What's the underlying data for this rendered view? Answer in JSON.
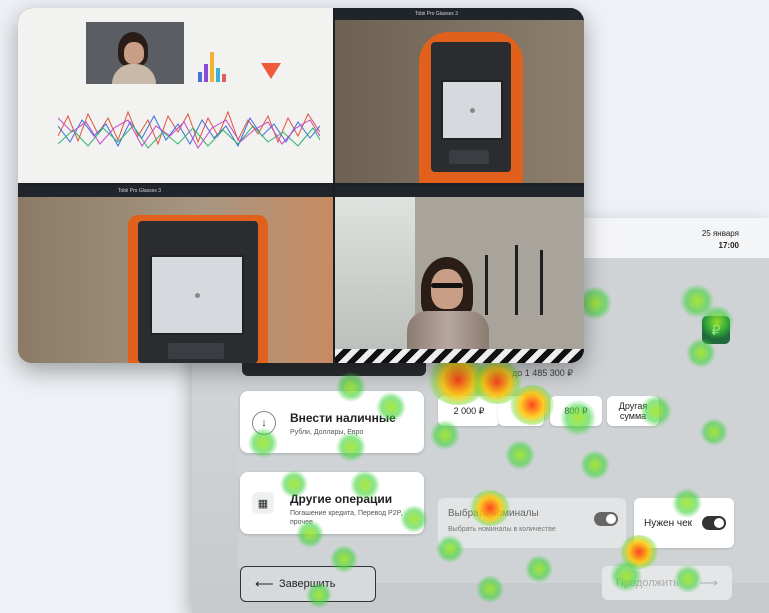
{
  "atm": {
    "date": "25 января",
    "time": "17:00",
    "ruble_icon": "₽",
    "limit_text": "до 1 485 300 ₽",
    "deposit": {
      "title": "Внести наличные",
      "subtitle": "Рубли, Доллары, Евро"
    },
    "other": {
      "title": "Другие операции",
      "subtitle": "Погашение кредита, Перевод P2P, прочее"
    },
    "amounts": [
      "2 000 ₽",
      "",
      "800 ₽",
      "Другая сумма"
    ],
    "nominal": {
      "title": "Выбрать номиналы",
      "subtitle": "Выбрать номиналы в количестве"
    },
    "receipt": {
      "label": "Нужен чек"
    },
    "finish_label": "Завершить",
    "continue_label": "Продолжить"
  },
  "video": {
    "q2_title": "Tobii Pro Glasses 3",
    "q3_title": "Tobii Pro Glasses 3"
  },
  "colors": {
    "kiosk_orange": "#e0601c",
    "brand_green": "#1f6b3b",
    "heat_green": "#5ad23c",
    "heat_red": "#ff3c14"
  }
}
